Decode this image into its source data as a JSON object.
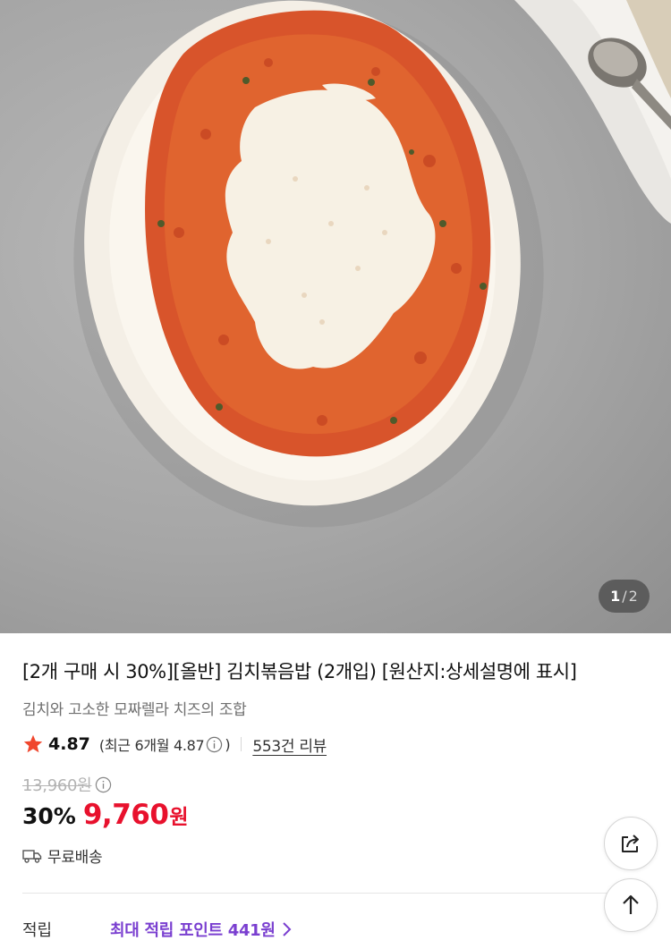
{
  "gallery": {
    "current": "1",
    "separator": "/",
    "total": "2"
  },
  "product": {
    "title": "[2개 구매 시 30%][올반] 김치볶음밥 (2개입) [원산지:상세설명에 표시]",
    "subtitle": "김치와 고소한 모짜렐라 치즈의 조합",
    "rating": "4.87",
    "recent_rating": "(최근 6개월 4.87",
    "recent_rating_close": ")",
    "review_count": "553건 리뷰",
    "original_price": "13,960원",
    "discount": "30%",
    "price": "9,760",
    "price_unit": "원",
    "shipping": "무료배송"
  },
  "points": {
    "label": "적립",
    "link": "최대 적립 포인트 441원"
  },
  "icons": {
    "rating": "star-icon",
    "info": "info-icon",
    "shipping": "truck-icon",
    "points": "chevron-right-icon",
    "share": "share-icon",
    "scroll_top": "arrow-up-icon"
  },
  "colors": {
    "star": "#f0462d",
    "price": "#e8112d",
    "points_link": "#7a3fd0"
  }
}
